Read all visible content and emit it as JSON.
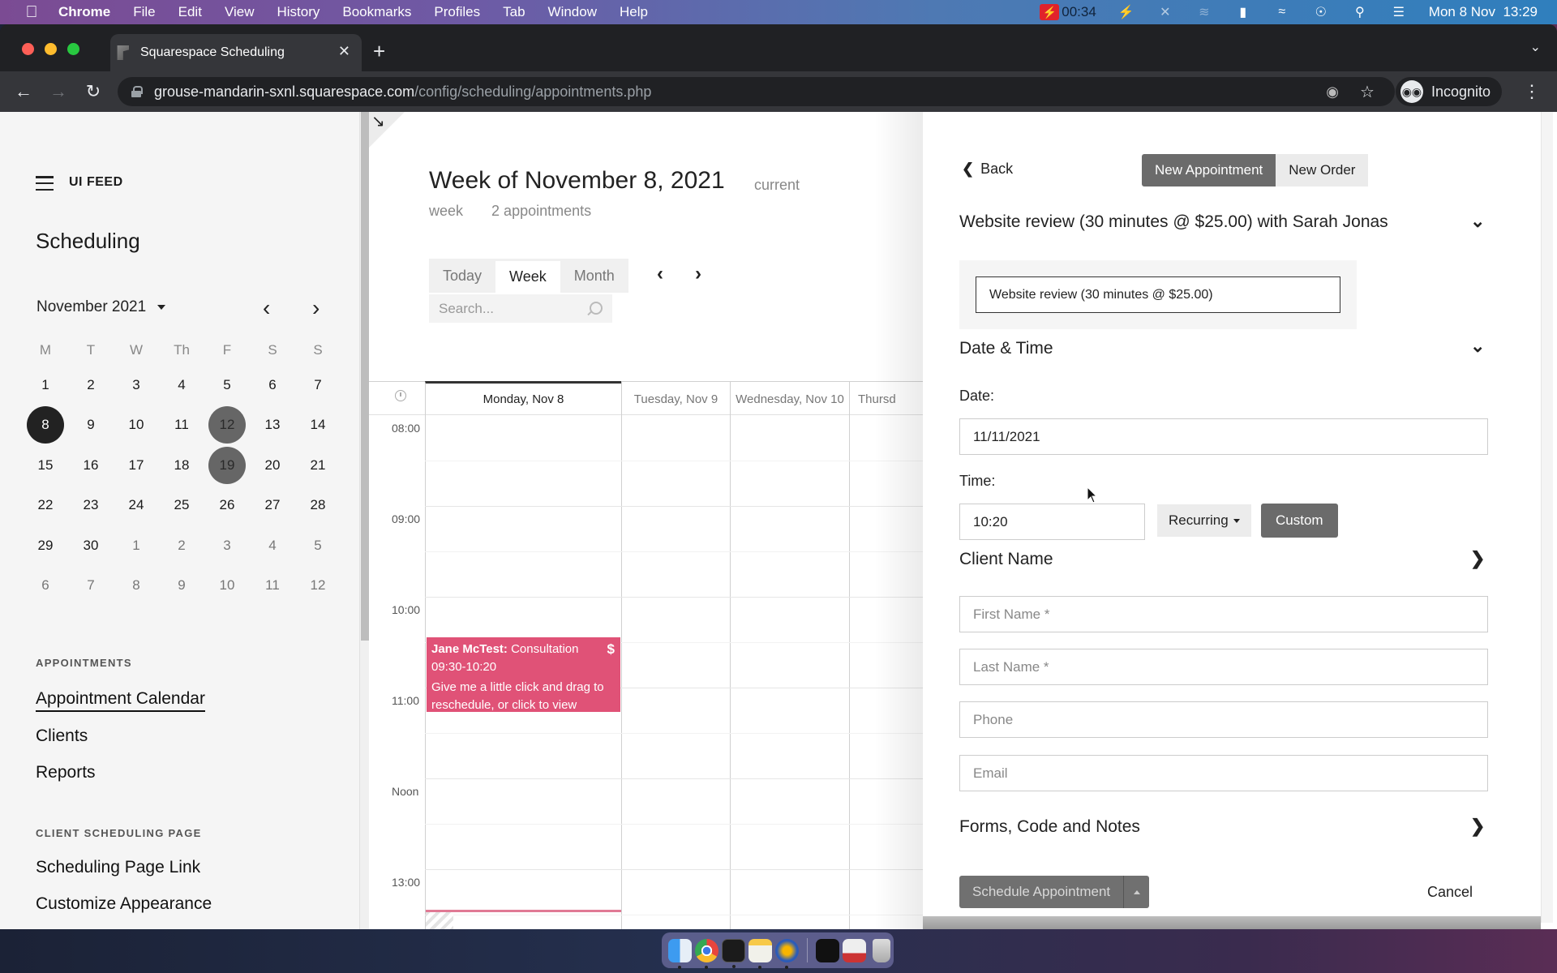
{
  "menubar": {
    "app": "Chrome",
    "items": [
      "File",
      "Edit",
      "View",
      "History",
      "Bookmarks",
      "Profiles",
      "Tab",
      "Window",
      "Help"
    ],
    "recording_time": "00:34",
    "datetime": "Mon 8 Nov  13:29",
    "status_icons": [
      "bolt-icon",
      "bluetooth-off-icon",
      "wifi-dim-icon",
      "battery-charging-icon",
      "wifi-icon",
      "user-icon",
      "search-icon",
      "control-center-icon"
    ]
  },
  "browser": {
    "tab_title": "Squarespace Scheduling",
    "url_host": "grouse-mandarin-sxnl.squarespace.com",
    "url_path": "/config/scheduling/appointments.php",
    "profile_label": "Incognito"
  },
  "sidebar": {
    "brand": "UI FEED",
    "title": "Scheduling",
    "mini_calendar": {
      "month_label": "November 2021",
      "weekdays": [
        "M",
        "T",
        "W",
        "Th",
        "F",
        "S",
        "S"
      ],
      "weeks": [
        [
          {
            "d": "1"
          },
          {
            "d": "2"
          },
          {
            "d": "3"
          },
          {
            "d": "4"
          },
          {
            "d": "5"
          },
          {
            "d": "6"
          },
          {
            "d": "7"
          }
        ],
        [
          {
            "d": "8",
            "state": "today"
          },
          {
            "d": "9"
          },
          {
            "d": "10"
          },
          {
            "d": "11"
          },
          {
            "d": "12",
            "state": "marked"
          },
          {
            "d": "13"
          },
          {
            "d": "14"
          }
        ],
        [
          {
            "d": "15"
          },
          {
            "d": "16"
          },
          {
            "d": "17"
          },
          {
            "d": "18"
          },
          {
            "d": "19",
            "state": "marked"
          },
          {
            "d": "20"
          },
          {
            "d": "21"
          }
        ],
        [
          {
            "d": "22"
          },
          {
            "d": "23"
          },
          {
            "d": "24"
          },
          {
            "d": "25"
          },
          {
            "d": "26"
          },
          {
            "d": "27"
          },
          {
            "d": "28"
          }
        ],
        [
          {
            "d": "29"
          },
          {
            "d": "30"
          },
          {
            "d": "1",
            "state": "other"
          },
          {
            "d": "2",
            "state": "other"
          },
          {
            "d": "3",
            "state": "other"
          },
          {
            "d": "4",
            "state": "other"
          },
          {
            "d": "5",
            "state": "other"
          }
        ],
        [
          {
            "d": "6",
            "state": "other"
          },
          {
            "d": "7",
            "state": "other"
          },
          {
            "d": "8",
            "state": "other"
          },
          {
            "d": "9",
            "state": "other"
          },
          {
            "d": "10",
            "state": "other"
          },
          {
            "d": "11",
            "state": "other"
          },
          {
            "d": "12",
            "state": "other"
          }
        ]
      ]
    },
    "appointments_heading": "APPOINTMENTS",
    "appointments_links": [
      "Appointment Calendar",
      "Clients",
      "Reports"
    ],
    "client_page_heading": "CLIENT SCHEDULING PAGE",
    "client_page_links": [
      "Scheduling Page Link",
      "Customize Appearance"
    ]
  },
  "calendar": {
    "title": "Week of November 8, 2021",
    "current_label_1": "current",
    "current_label_2": "week",
    "appointment_count": "2 appointments",
    "views": [
      "Today",
      "Week",
      "Month"
    ],
    "active_view": "Week",
    "search_placeholder": "Search...",
    "days": [
      "Monday, Nov 8",
      "Tuesday, Nov 9",
      "Wednesday, Nov 10",
      "Thursd"
    ],
    "hours": [
      "08:00",
      "09:00",
      "10:00",
      "11:00",
      "Noon",
      "13:00"
    ],
    "event": {
      "client": "Jane McTest:",
      "type": "Consultation",
      "time": "09:30-10:20",
      "note": "Give me a little click and drag to reschedule, or click to view",
      "paid_marker": "$",
      "color": "#e05277"
    }
  },
  "form": {
    "back_label": "Back",
    "tabs": [
      "New Appointment",
      "New Order"
    ],
    "service_heading": "Website review (30 minutes @ $25.00) with Sarah Jonas",
    "service_selected": "Website review (30 minutes @ $25.00)",
    "datetime_heading": "Date & Time",
    "date_label": "Date:",
    "date_value": "11/11/2021",
    "time_label": "Time:",
    "time_value": "10:20",
    "recurring_label": "Recurring",
    "custom_label": "Custom",
    "client_heading": "Client Name",
    "first_name_placeholder": "First Name *",
    "last_name_placeholder": "Last Name *",
    "phone_placeholder": "Phone",
    "email_placeholder": "Email",
    "forms_heading": "Forms, Code and Notes",
    "schedule_label": "Schedule Appointment",
    "cancel_label": "Cancel"
  },
  "dock": {
    "apps": [
      "Finder",
      "Chrome",
      "Terminal",
      "Notes",
      "Flash app",
      "Screen recorder",
      "Preview window",
      "Trash"
    ]
  }
}
